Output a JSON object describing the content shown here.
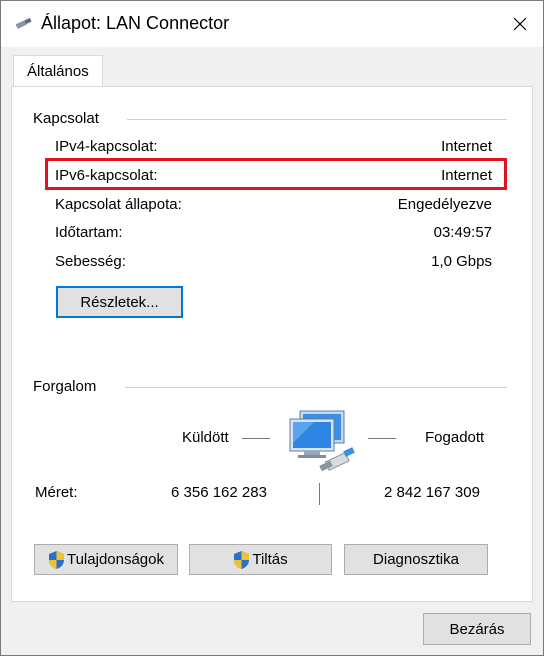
{
  "window": {
    "title": "Állapot: LAN Connector",
    "close_label": "close"
  },
  "tabs": [
    {
      "label": "Általános"
    }
  ],
  "connection": {
    "group_label": "Kapcsolat",
    "rows": [
      {
        "label": "IPv4-kapcsolat:",
        "value": "Internet"
      },
      {
        "label": "IPv6-kapcsolat:",
        "value": "Internet"
      },
      {
        "label": "Kapcsolat állapota:",
        "value": "Engedélyezve"
      },
      {
        "label": "Időtartam:",
        "value": "03:49:57"
      },
      {
        "label": "Sebesség:",
        "value": "1,0 Gbps"
      }
    ],
    "details_button": "Részletek..."
  },
  "traffic": {
    "group_label": "Forgalom",
    "sent_label": "Küldött",
    "received_label": "Fogadott",
    "size_label": "Méret:",
    "sent_value": "6 356 162 283",
    "received_value": "2 842 167 309"
  },
  "buttons": {
    "properties": "Tulajdonságok",
    "disable": "Tiltás",
    "diagnose": "Diagnosztika",
    "close": "Bezárás"
  },
  "colors": {
    "highlight": "#e0141e",
    "focus": "#0078d7"
  },
  "icons": {
    "title": "network-cable-icon",
    "traffic": "network-computers-icon",
    "shield": "uac-shield-icon"
  }
}
